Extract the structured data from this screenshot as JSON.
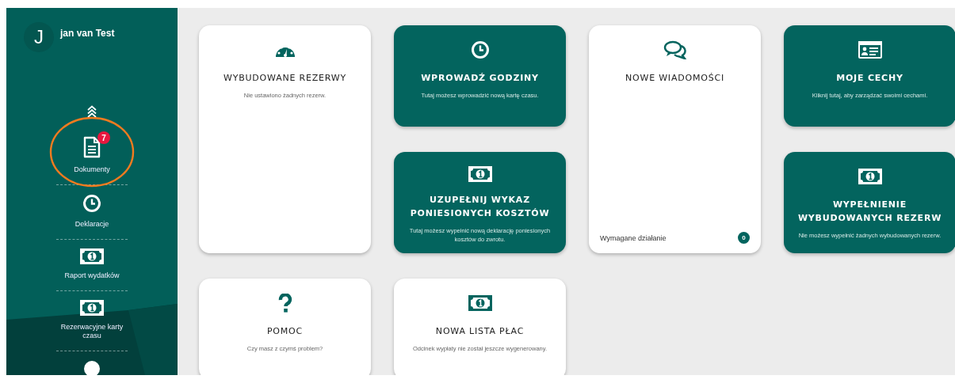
{
  "sidebar": {
    "user": {
      "initial": "J",
      "name": "jan van Test"
    },
    "items": [
      {
        "kind": "document",
        "label": "Dokumenty",
        "badge": "7",
        "circled": true
      },
      {
        "kind": "clock",
        "label": "Deklaracje",
        "circled": false
      },
      {
        "kind": "money",
        "label": "Raport wydatków",
        "circled": false
      },
      {
        "kind": "money",
        "label": "Rezerwacyjne karty czasu",
        "circled": false
      },
      {
        "kind": "circle",
        "circled": false
      }
    ]
  },
  "cards": [
    {
      "kind": "gauge",
      "filled": false,
      "title": "WYBUDOWANE REZERWY",
      "description": "Nie ustawiono żadnych rezerw.",
      "tall": true
    },
    {
      "kind": "clock",
      "filled": true,
      "title": "WPROWADŹ GODZINY",
      "description": "Tutaj możesz wprowadzić nową kartę czasu.",
      "tall": false
    },
    {
      "kind": "chat",
      "filled": false,
      "title": "NOWE WIADOMOŚCI",
      "tall": true,
      "footer": {
        "label": "Wymagane działanie",
        "count": "0"
      }
    },
    {
      "kind": "idcard",
      "filled": true,
      "title": "MOJE CECHY",
      "description": "Kliknij tutaj, aby zarządzać swoimi cechami.",
      "tall": false
    },
    {
      "kind": "money",
      "filled": true,
      "title": "UZUPEŁNIJ WYKAZ PONIESIONYCH KOSZTÓW",
      "description": "Tutaj możesz wypełnić nową deklarację poniesionych kosztów do zwrotu.",
      "tall": false
    },
    {
      "kind": "money",
      "filled": true,
      "title": "WYPEŁNIENIE WYBUDOWANYCH REZERW",
      "description": "Nie możesz wypełnić żadnych wybudowanych rezerw.",
      "tall": false
    },
    {
      "kind": "question",
      "filled": false,
      "title": "POMOC",
      "description": "Czy masz z czymś problem?",
      "tall": false
    },
    {
      "kind": "money",
      "filled": false,
      "title": "NOWA LISTA PŁAC",
      "description": "Odcinek wypłaty nie został jeszcze wygenerowany.",
      "tall": false
    }
  ]
}
